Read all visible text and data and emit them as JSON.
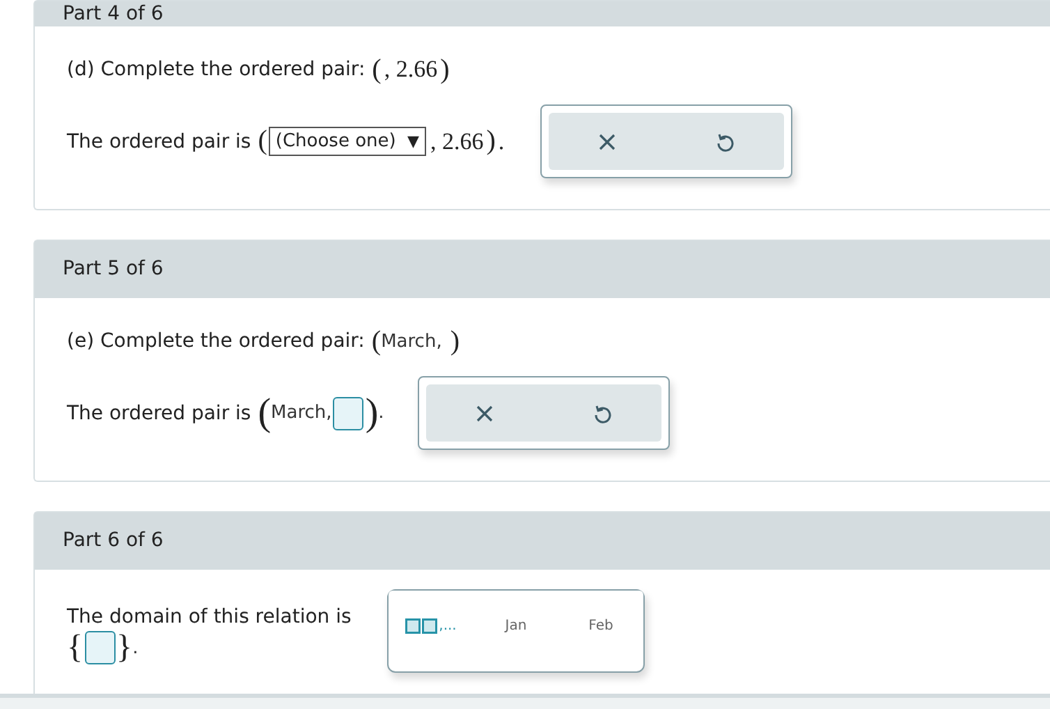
{
  "parts": [
    {
      "header": "Part 4 of 6",
      "question": {
        "label": "(d) Complete the ordered pair:",
        "open": "(",
        "inner": ",",
        "value": "2.66",
        "close": ")"
      },
      "answer": {
        "kind": "choice",
        "lead": "The ordered pair is",
        "open": "(",
        "select_value": "(Choose one)",
        "caret": "▼",
        "after": ", 2.66",
        "close": ")",
        "end": "."
      },
      "tools": [
        {
          "kind": "clear"
        },
        {
          "kind": "reset"
        }
      ]
    },
    {
      "header": "Part 5 of 6",
      "question": {
        "label": "(e) Complete the ordered pair:",
        "open": "(",
        "inner": "March,",
        "close": ")"
      },
      "answer": {
        "kind": "pair_blank",
        "lead": "The ordered pair is",
        "open": "(",
        "before": "March,",
        "close": ")",
        "end": "."
      },
      "tools": [
        {
          "kind": "clear"
        },
        {
          "kind": "reset"
        }
      ]
    },
    {
      "header": "Part 6 of 6",
      "answer": {
        "kind": "set_blank",
        "lead": "The domain of this relation is",
        "open": "{",
        "close": "}",
        "end": "."
      },
      "tools": [
        {
          "kind": "set_template",
          "label": ",..."
        },
        {
          "kind": "word",
          "label": "Jan"
        },
        {
          "kind": "word",
          "label": "Feb"
        }
      ]
    }
  ]
}
